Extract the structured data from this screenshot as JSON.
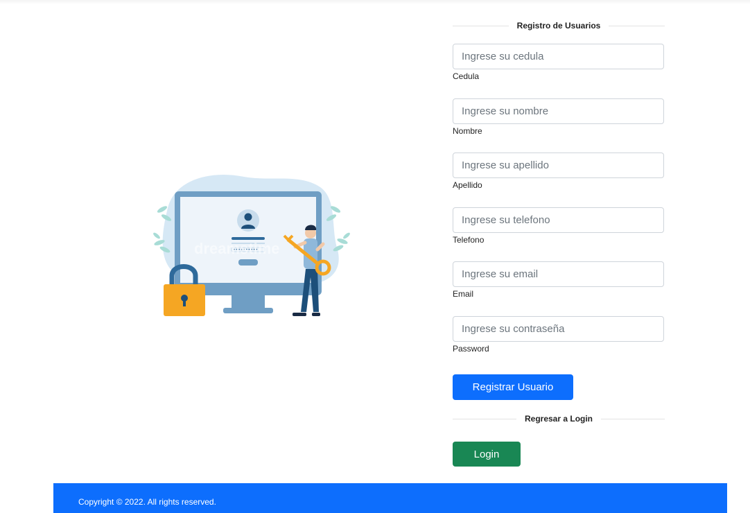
{
  "register": {
    "title": "Registro de Usuarios",
    "fields": [
      {
        "placeholder": "Ingrese su cedula",
        "label": "Cedula",
        "value": ""
      },
      {
        "placeholder": "Ingrese su nombre",
        "label": "Nombre",
        "value": ""
      },
      {
        "placeholder": "Ingrese su apellido",
        "label": "Apellido",
        "value": ""
      },
      {
        "placeholder": "Ingrese su telefono",
        "label": "Telefono",
        "value": ""
      },
      {
        "placeholder": "Ingrese su email",
        "label": "Email",
        "value": ""
      },
      {
        "placeholder": "Ingrese su contraseña",
        "label": "Password",
        "value": ""
      }
    ],
    "submit_label": "Registrar Usuario"
  },
  "login_section": {
    "title": "Regresar a Login",
    "button_label": "Login"
  },
  "footer": {
    "copyright": "Copyright © 2022. All rights reserved."
  },
  "illustration": {
    "watermark": "dreamstime"
  },
  "colors": {
    "primary": "#0d6efd",
    "success": "#198754",
    "lock": "#f5a623",
    "monitor": "#6f9ec4",
    "blob": "#d6e8f5"
  }
}
